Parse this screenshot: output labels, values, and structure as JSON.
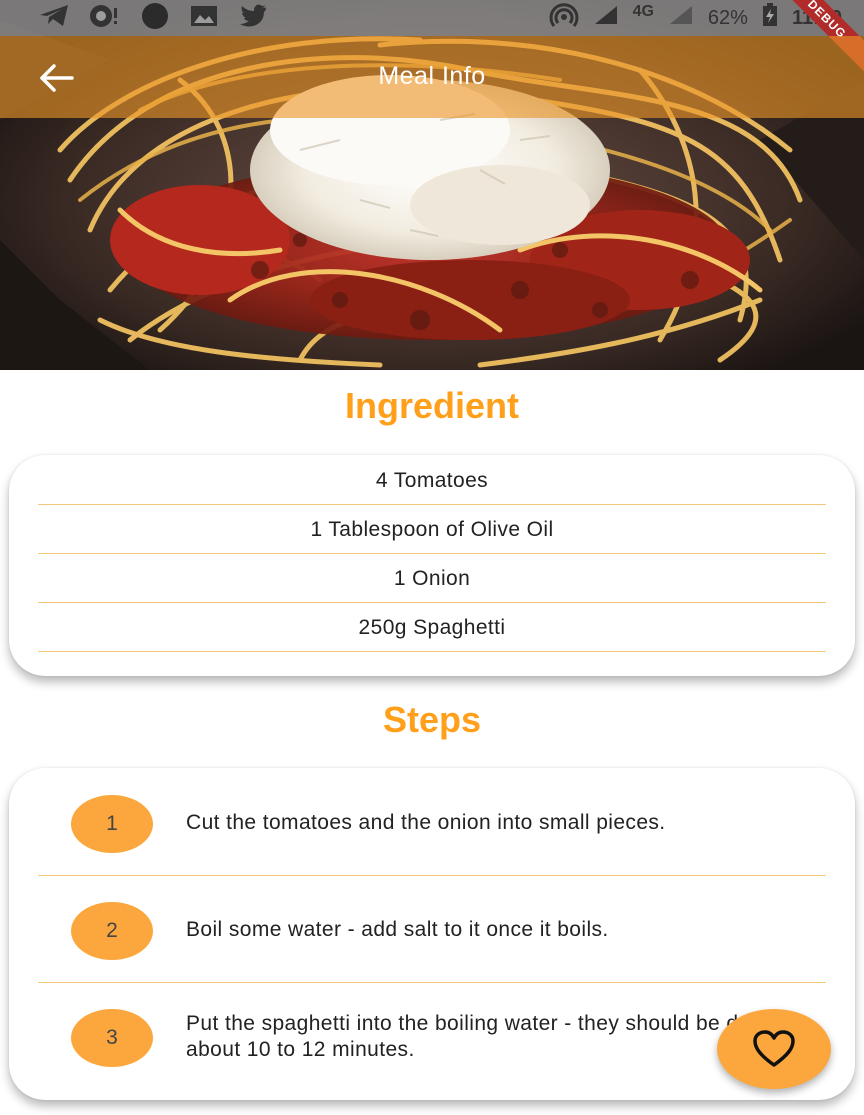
{
  "status_bar": {
    "network_type": "4G",
    "battery": "62%",
    "time": "11:50",
    "icons": [
      "telegram-icon",
      "messenger-icon",
      "circle-icon",
      "gallery-icon",
      "twitter-icon",
      "hotspot-icon",
      "signal-icon",
      "battery-icon"
    ]
  },
  "debug_banner": "DEBUG",
  "app_bar": {
    "title": "Meal Info",
    "back_icon": "arrow-back-icon"
  },
  "ingredients": {
    "title": "Ingredient",
    "items": [
      "4 Tomatoes",
      "1 Tablespoon of Olive Oil",
      "1 Onion",
      "250g Spaghetti"
    ]
  },
  "steps": {
    "title": "Steps",
    "items": [
      {
        "number": "1",
        "text": "Cut the tomatoes and the onion into small pieces."
      },
      {
        "number": "2",
        "text": "Boil some water - add salt to it once it boils."
      },
      {
        "number": "3",
        "text": "Put the spaghetti into the boiling water - they should be done in about 10 to 12 minutes."
      }
    ]
  },
  "fab": {
    "icon": "heart-outline-icon"
  },
  "colors": {
    "accent": "#ff9f1a",
    "badge": "#fba73e",
    "divider": "#f5c77a",
    "app_bar": "#ec9628"
  }
}
